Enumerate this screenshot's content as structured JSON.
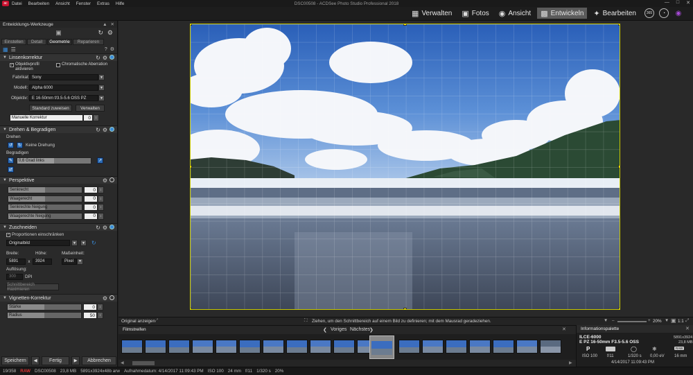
{
  "app": {
    "logo": "ac",
    "menu": [
      "Datei",
      "Bearbeiten",
      "Ansicht",
      "Fenster",
      "Extras",
      "Hilfe"
    ],
    "window_title": "DSC00508 - ACDSee Photo Studio Professional 2018",
    "modes": [
      {
        "label": "Verwalten",
        "icon": "grid-icon"
      },
      {
        "label": "Fotos",
        "icon": "photos-icon"
      },
      {
        "label": "Ansicht",
        "icon": "eye-icon"
      },
      {
        "label": "Entwickeln",
        "icon": "develop-icon",
        "active": true
      },
      {
        "label": "Bearbeiten",
        "icon": "edit-icon"
      }
    ],
    "mode_round_label": "365"
  },
  "left_panel": {
    "title": "Entwicklungs-Werkzeuge",
    "tabs": [
      "Einstellen",
      "Detail",
      "Geometrie",
      "Reparieren"
    ],
    "lens": {
      "title": "Linsenkorrektur",
      "profile_label": "Objektivprofil aktivieren",
      "chromatic_label": "Chromatische Aberration",
      "maker_label": "Fabrikat:",
      "maker_value": "Sony",
      "model_label": "Modell:",
      "model_value": "Alpha 6000",
      "lens_label": "Objektiv:",
      "lens_value": "E 16-50mm f/3.5-5.6 OSS PZ",
      "btn_default": "Standard zuweisen",
      "btn_manage": "Verwalten",
      "manual_label": "Manuelle Korrektur",
      "manual_value": "0"
    },
    "rotate": {
      "title": "Drehen & Begradigen",
      "rotate_label": "Drehen",
      "rotate_value": "Keine Drehung",
      "straighten_label": "Begradigen",
      "straighten_value": "0,6 Grad links"
    },
    "perspective": {
      "title": "Perspektive",
      "rows": [
        {
          "label": "Senkrecht",
          "value": "0"
        },
        {
          "label": "Waagerecht",
          "value": "0"
        },
        {
          "label": "Senkrechte Neigung",
          "value": "0"
        },
        {
          "label": "Waagerechte Neigung",
          "value": "0"
        }
      ]
    },
    "crop": {
      "title": "Zuschneiden",
      "proportions_label": "Proportionen einschränken",
      "ratio_value": "Originalbild",
      "width_label": "Breite:",
      "height_label": "Höhe:",
      "unit_label": "Maßeinheit:",
      "width_value": "5891",
      "x_sep": "x",
      "height_value": "3924",
      "unit_value": "Pixel",
      "res_label": "Auflösung:",
      "res_value": "300",
      "res_unit": "DPI",
      "maximize_label": "Schnittbereich maximieren"
    },
    "vignette": {
      "title": "Vignetten-Korrektur",
      "rows": [
        {
          "label": "Stärke",
          "value": "0"
        },
        {
          "label": "Radius",
          "value": "50"
        }
      ]
    },
    "footer": {
      "save": "Speichern",
      "done": "Fertig",
      "cancel": "Abbrechen"
    }
  },
  "canvas": {
    "show_original": "Original anzeigen",
    "hint": "Ziehen, um den Schnittbereich auf einem Bild zu definieren; mit dem Mausrad geradeziehen.",
    "zoom": "20%",
    "ratio": "1:1"
  },
  "filmstrip": {
    "title": "Filmstreifen",
    "prev": "Voriges",
    "next": "Nächstes"
  },
  "info_palette": {
    "title": "Informationspalette",
    "camera": "ILCE-6000",
    "lens": "E PZ 16-50mm F3.5-5.6 OSS",
    "dimensions": "5891x3924",
    "filesize": "23,8 MB",
    "mode": "P",
    "iso": "ISO 100",
    "aperture": "f/11",
    "shutter": "1/320 s",
    "ev": "0,00 eV",
    "focal": "16 mm",
    "date": "4/14/2017 11:09:43 PM",
    "raw_label": "RAW"
  },
  "status": {
    "index": "19/358",
    "raw": "RAW",
    "filename": "DSC00508",
    "size": "23,8 MB",
    "dims": "5891x3924x48b arw",
    "date": "Aufnahmedatum: 4/14/2017 11:09:43 PM",
    "iso": "ISO 100",
    "focal": "24 mm",
    "aperture": "f/11",
    "shutter": "1/320 s",
    "zoom": "20%"
  }
}
